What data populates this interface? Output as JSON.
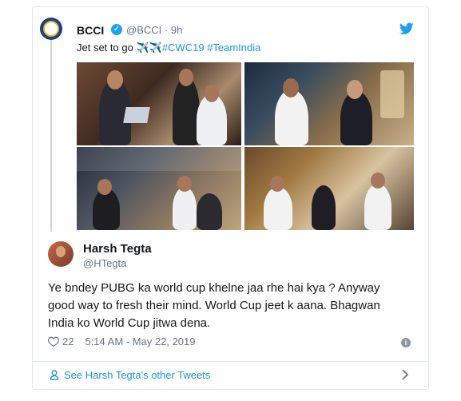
{
  "quoted_tweet": {
    "name": "BCCI",
    "handle": "@BCCI",
    "separator": "·",
    "time": "9h",
    "text_prefix": "Jet set to go ",
    "text_emoji": "✈️✈️",
    "hashtags": "#CWC19 #TeamIndia",
    "verified_glyph": "✓"
  },
  "tweet": {
    "name": "Harsh Tegta",
    "handle": "@HTegta",
    "body_lines": [
      "Ye bndey PUBG ka world cup khelne jaa rhe hai kya ? Anyway",
      "good way to fresh their mind. World Cup jeet k aana. Bhagwan",
      "India ko World Cup jitwa dena."
    ],
    "likes": "22",
    "timestamp": "5:14 AM - May 22, 2019",
    "info_glyph": "i"
  },
  "footer": {
    "link_text": "See Harsh Tegta's other Tweets"
  },
  "icons": {
    "heart": "heart-icon",
    "info": "info-icon",
    "twitter": "twitter-bird-icon",
    "person": "person-icon",
    "chevron": "chevron-right-icon",
    "verified": "verified-badge-icon"
  },
  "colors": {
    "link": "#1b95e0",
    "muted": "#657786",
    "twitter_blue": "#1da1f2",
    "border": "#e1e8ed"
  }
}
